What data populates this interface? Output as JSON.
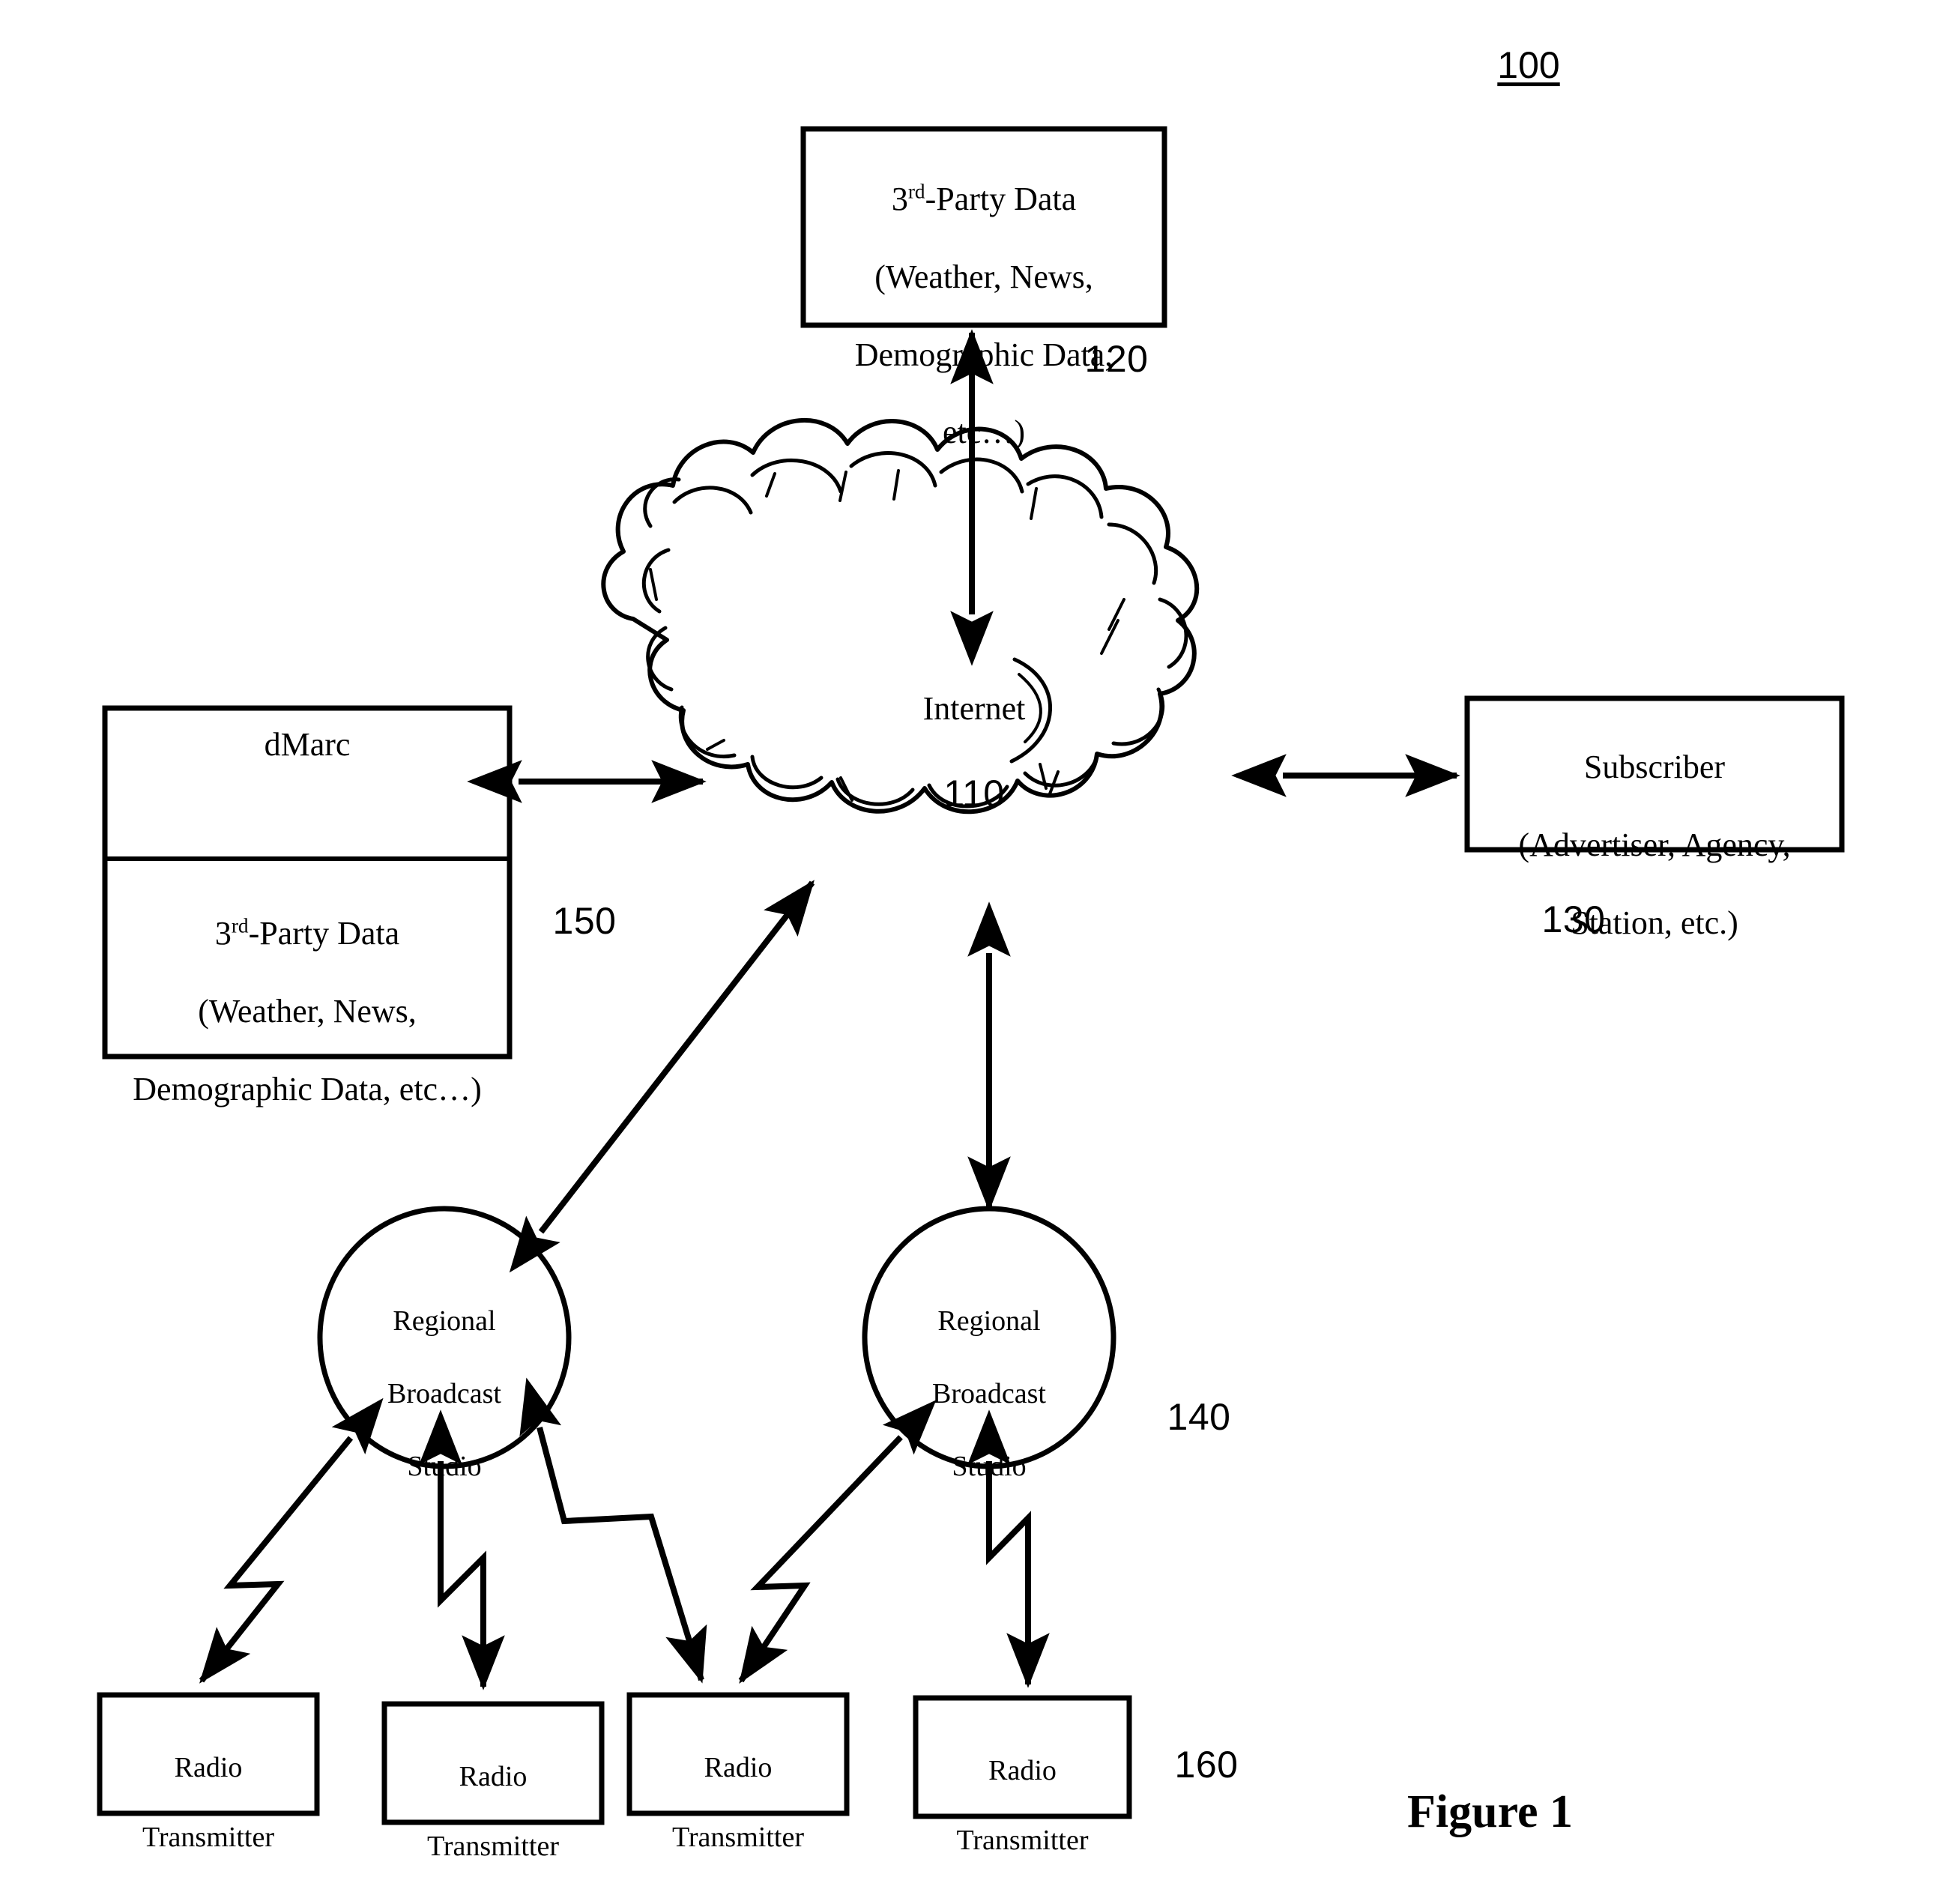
{
  "figure": {
    "system_number": "100",
    "caption": "Figure 1"
  },
  "nodes": {
    "third_party_data": {
      "ref": "120",
      "line1_pre": "3",
      "line1_sup": "rd",
      "line1_post": "-Party Data",
      "line2": "(Weather, News,",
      "line3": "Demographic Data,",
      "line4": "etc…)"
    },
    "internet_cloud": {
      "label": "Internet",
      "ref": "110"
    },
    "dmarc": {
      "ref": "150",
      "title": "dMarc",
      "data_line1_pre": "3",
      "data_line1_sup": "rd",
      "data_line1_post": "-Party Data",
      "data_line2": "(Weather, News,",
      "data_line3": "Demographic Data, etc…)"
    },
    "subscriber": {
      "ref": "130",
      "line1": "Subscriber",
      "line2": "(Advertiser, Agency,",
      "line3": "Station, etc.)"
    },
    "studios": {
      "ref": "140",
      "items": [
        {
          "line1": "Regional",
          "line2": "Broadcast",
          "line3": "Studio"
        },
        {
          "line1": "Regional",
          "line2": "Broadcast",
          "line3": "Studio"
        }
      ]
    },
    "transmitters": {
      "ref": "160",
      "items": [
        {
          "line1": "Radio",
          "line2": "Transmitter"
        },
        {
          "line1": "Radio",
          "line2": "Transmitter"
        },
        {
          "line1": "Radio",
          "line2": "Transmitter"
        },
        {
          "line1": "Radio",
          "line2": "Transmitter"
        }
      ]
    }
  },
  "colors": {
    "ink": "#000000",
    "paper": "#ffffff"
  }
}
